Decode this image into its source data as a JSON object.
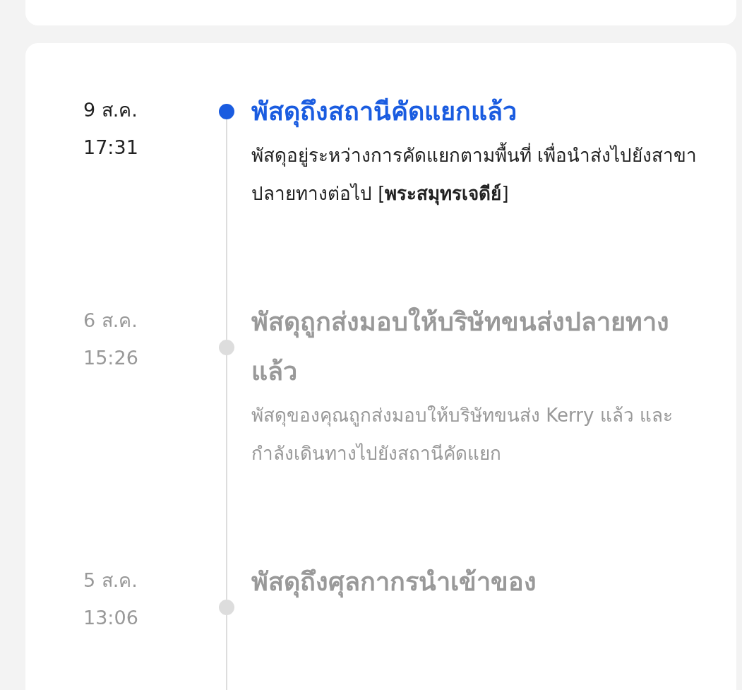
{
  "events": [
    {
      "date": "9 ส.ค.",
      "time": "17:31",
      "current": true,
      "title": "พัสดุถึงสถานีคัดแยกแล้ว",
      "description": "พัสดุอยู่ระหว่างการคัดแยกตามพื้นที่ เพื่อนำส่งไปยังสาขาปลายทางต่อไป [**พระสมุทรเจดีย์**]"
    },
    {
      "date": "6 ส.ค.",
      "time": "15:26",
      "current": false,
      "title": "พัสดุถูกส่งมอบให้บริษัทขนส่งปลายทางแล้ว",
      "description": "พัสดุของคุณถูกส่งมอบให้บริษัทขนส่ง Kerry แล้ว และกำลังเดินทางไปยังสถานีคัดแยก"
    },
    {
      "date": "5 ส.ค.",
      "time": "13:06",
      "current": false,
      "title": "พัสดุถึงศุลกากรนำเข้าของ"
    }
  ]
}
